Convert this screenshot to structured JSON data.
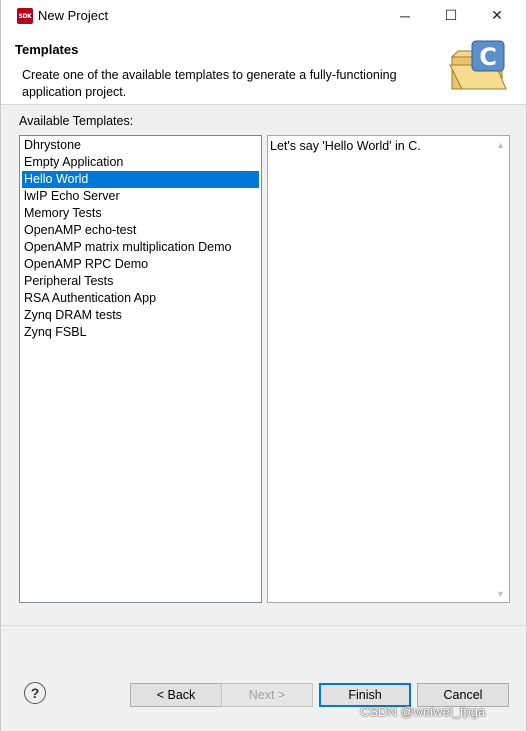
{
  "window": {
    "title": "New Project",
    "app_icon_text": "SDK",
    "minimize_glyph": "─",
    "maximize_glyph": "☐",
    "close_glyph": "✕"
  },
  "header": {
    "title": "Templates",
    "description": "Create one of the available templates to generate a fully-functioning application project.",
    "icon": "folder-c-icon"
  },
  "templates": {
    "label": "Available Templates:",
    "items": [
      "Dhrystone",
      "Empty Application",
      "Hello World",
      "lwIP Echo Server",
      "Memory Tests",
      "OpenAMP echo-test",
      "OpenAMP matrix multiplication Demo",
      "OpenAMP RPC Demo",
      "Peripheral Tests",
      "RSA Authentication App",
      "Zynq DRAM tests",
      "Zynq FSBL"
    ],
    "selected_index": 2
  },
  "description_panel": {
    "text": "Let's say 'Hello World' in C."
  },
  "buttons": {
    "help": "?",
    "back": "< Back",
    "next": "Next >",
    "finish": "Finish",
    "cancel": "Cancel"
  },
  "watermark": "CSDN @weiwei_fpga",
  "colors": {
    "selection": "#0078d7",
    "dialog_bg": "#f0f0f0",
    "header_bg": "#ffffff"
  }
}
